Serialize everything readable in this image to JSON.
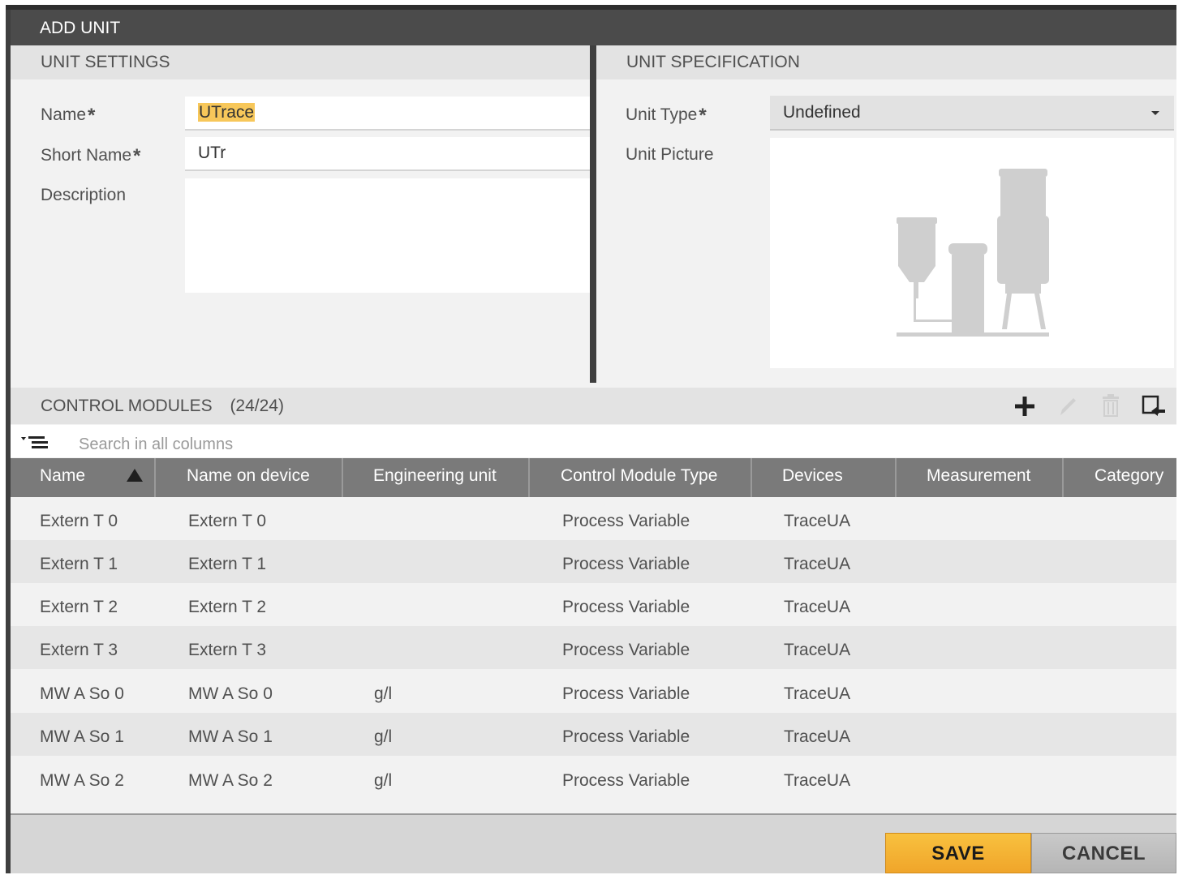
{
  "dialog": {
    "title": "ADD UNIT"
  },
  "unit_settings": {
    "header": "UNIT SETTINGS",
    "name_label": "Name",
    "name_value": "UTrace",
    "short_name_label": "Short Name",
    "short_name_value": "UTr",
    "description_label": "Description",
    "description_value": "",
    "required_mark": "*"
  },
  "unit_specification": {
    "header": "UNIT SPECIFICATION",
    "unit_type_label": "Unit Type",
    "unit_type_value": "Undefined",
    "unit_picture_label": "Unit Picture"
  },
  "control_modules": {
    "header": "CONTROL MODULES",
    "count": "(24/24)",
    "search_placeholder": "Search in all columns",
    "columns": [
      "Name",
      "Name on device",
      "Engineering unit",
      "Control Module Type",
      "Devices",
      "Measurement",
      "Category"
    ],
    "rows": [
      {
        "name": "Extern T 0",
        "name_on_device": "Extern T 0",
        "engineering_unit": "",
        "type": "Process Variable",
        "devices": "TraceUA",
        "measurement": "",
        "category": ""
      },
      {
        "name": "Extern T 1",
        "name_on_device": "Extern T 1",
        "engineering_unit": "",
        "type": "Process Variable",
        "devices": "TraceUA",
        "measurement": "",
        "category": ""
      },
      {
        "name": "Extern T 2",
        "name_on_device": "Extern T 2",
        "engineering_unit": "",
        "type": "Process Variable",
        "devices": "TraceUA",
        "measurement": "",
        "category": ""
      },
      {
        "name": "Extern T 3",
        "name_on_device": "Extern T 3",
        "engineering_unit": "",
        "type": "Process Variable",
        "devices": "TraceUA",
        "measurement": "",
        "category": ""
      },
      {
        "name": "MW A So 0",
        "name_on_device": "MW A So 0",
        "engineering_unit": "g/l",
        "type": "Process Variable",
        "devices": "TraceUA",
        "measurement": "",
        "category": ""
      },
      {
        "name": "MW A So 1",
        "name_on_device": "MW A So 1",
        "engineering_unit": "g/l",
        "type": "Process Variable",
        "devices": "TraceUA",
        "measurement": "",
        "category": ""
      },
      {
        "name": "MW A So 2",
        "name_on_device": "MW A So 2",
        "engineering_unit": "g/l",
        "type": "Process Variable",
        "devices": "TraceUA",
        "measurement": "",
        "category": ""
      }
    ]
  },
  "footer": {
    "save_label": "SAVE",
    "cancel_label": "CANCEL"
  },
  "colors": {
    "accent": "#f5b335",
    "header_bar": "#7a7a7a",
    "title_bar": "#4b4b4b",
    "highlight": "#f7c75a"
  },
  "icons": {
    "add": "plus-icon",
    "edit": "pencil-icon",
    "delete": "trash-icon",
    "assign": "assign-window-icon",
    "filter": "filter-menu-icon"
  }
}
